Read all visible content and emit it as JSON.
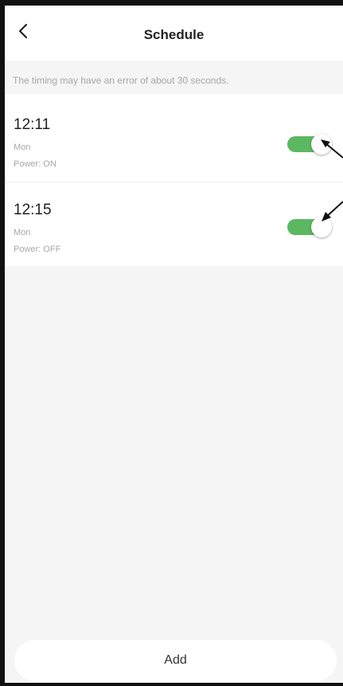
{
  "header": {
    "back_icon": "chevron-left-icon",
    "title": "Schedule"
  },
  "notice": "The timing may have an error of about 30 seconds.",
  "schedules": [
    {
      "time": "12:11",
      "day": "Mon",
      "power": "Power: ON",
      "enabled": true
    },
    {
      "time": "12:15",
      "day": "Mon",
      "power": "Power: OFF",
      "enabled": true
    }
  ],
  "add_label": "Add",
  "colors": {
    "toggle_on": "#5cb860",
    "background": "#f5f5f6",
    "annotation_arrow": "#111111"
  }
}
